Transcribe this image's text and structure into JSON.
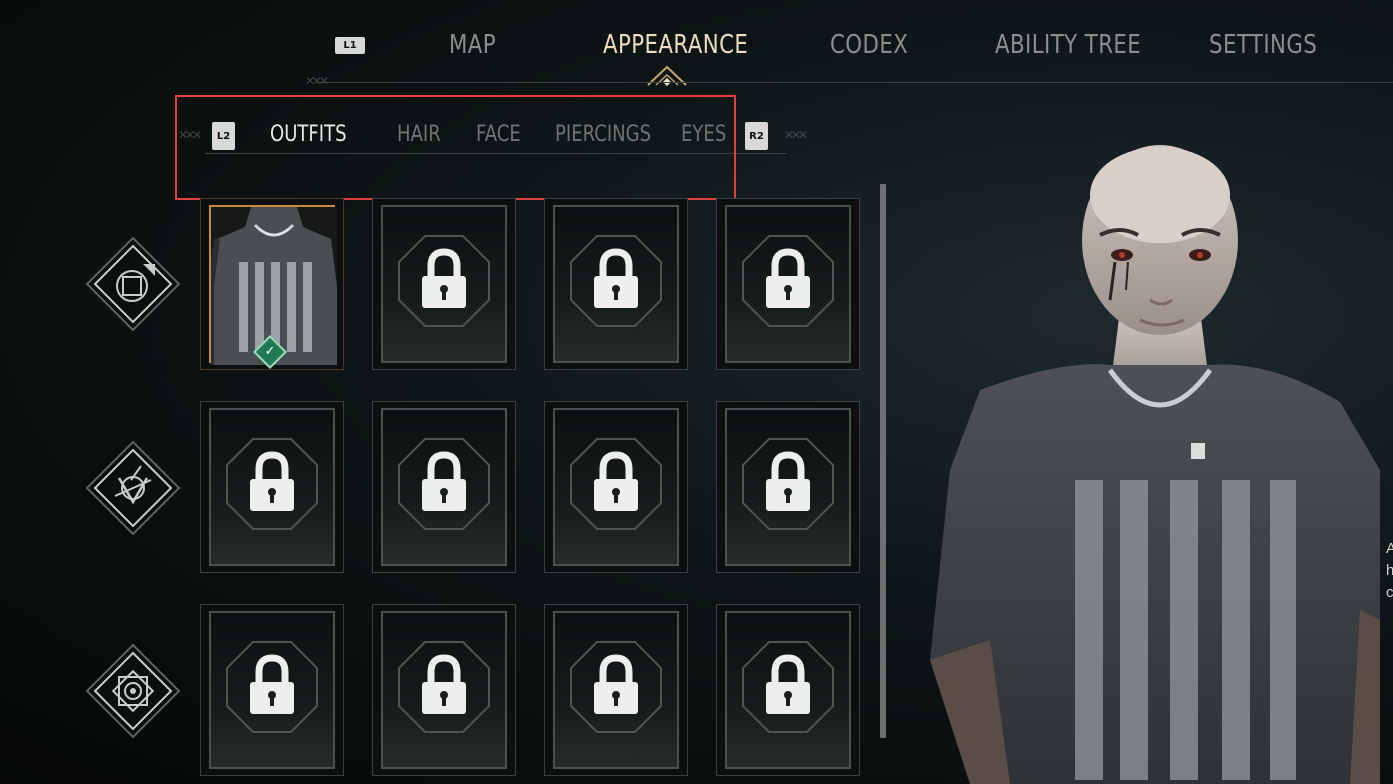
{
  "top_nav": {
    "left_button": "L1",
    "tabs": [
      {
        "label": "MAP",
        "active": false
      },
      {
        "label": "APPEARANCE",
        "active": true
      },
      {
        "label": "CODEX",
        "active": false
      },
      {
        "label": "ABILITY TREE",
        "active": false
      },
      {
        "label": "SETTINGS",
        "active": false
      }
    ]
  },
  "sub_nav": {
    "left_button": "L2",
    "right_button": "R2",
    "tabs": [
      {
        "label": "OUTFITS",
        "active": true
      },
      {
        "label": "HAIR",
        "active": false
      },
      {
        "label": "FACE",
        "active": false
      },
      {
        "label": "PIERCINGS",
        "active": false
      },
      {
        "label": "EYES",
        "active": false
      }
    ]
  },
  "categories": [
    {
      "icon": "square-emblem-icon"
    },
    {
      "icon": "rune-triangle-icon"
    },
    {
      "icon": "star-emblem-icon"
    }
  ],
  "grid": {
    "rows": 3,
    "columns": 4,
    "equipped_slot": "outfit-1",
    "slots": [
      {
        "state": "equipped",
        "icon": "tshirt-icon"
      },
      {
        "state": "locked",
        "icon": "lock-icon"
      },
      {
        "state": "locked",
        "icon": "lock-icon"
      },
      {
        "state": "locked",
        "icon": "lock-icon"
      },
      {
        "state": "locked",
        "icon": "lock-icon"
      },
      {
        "state": "locked",
        "icon": "lock-icon"
      },
      {
        "state": "locked",
        "icon": "lock-icon"
      },
      {
        "state": "locked",
        "icon": "lock-icon"
      },
      {
        "state": "locked",
        "icon": "lock-icon"
      },
      {
        "state": "locked",
        "icon": "lock-icon"
      },
      {
        "state": "locked",
        "icon": "lock-icon"
      },
      {
        "state": "locked",
        "icon": "lock-icon"
      }
    ]
  },
  "edge_text": [
    "A",
    "h",
    "c"
  ],
  "colors": {
    "active_tab": "#ecdcc0",
    "inactive_tab": "#8a8f8e",
    "equipped_border": "#c8893c",
    "check_badge": "#1f7a55",
    "highlight": "#e04040"
  }
}
